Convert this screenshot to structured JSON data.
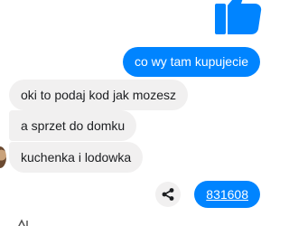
{
  "conversation": {
    "messages": [
      {
        "direction": "outgoing",
        "text": "co wy tam kupujecie"
      },
      {
        "direction": "incoming",
        "text": "oki to podaj kod jak mozesz"
      },
      {
        "direction": "incoming",
        "text": "a sprzet do domku"
      },
      {
        "direction": "incoming",
        "text": "kuchenka i lodowka"
      },
      {
        "direction": "outgoing",
        "text": "831608",
        "is_link": true
      }
    ]
  },
  "icons": {
    "like": "thumbs-up-icon",
    "share": "share-icon"
  },
  "colors": {
    "outgoing_bubble": "#0084ff",
    "incoming_bubble": "#f1f0f0",
    "incoming_text": "#1c1e21",
    "outgoing_text": "#ffffff"
  }
}
